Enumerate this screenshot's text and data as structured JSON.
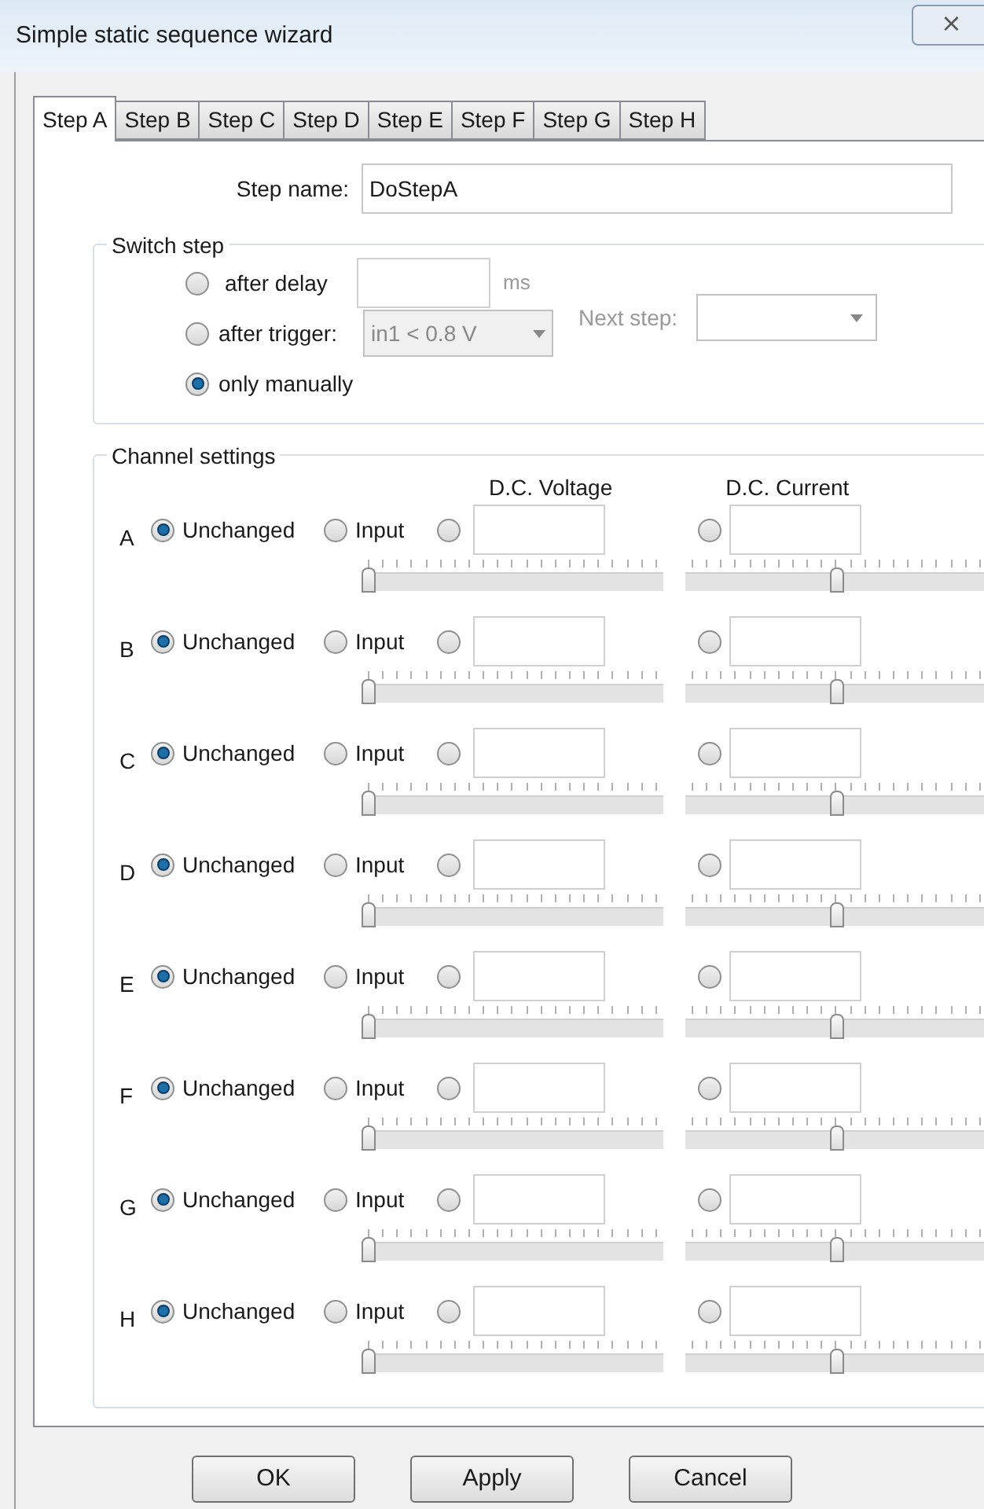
{
  "window": {
    "title": "Simple static sequence wizard",
    "close": "⨯"
  },
  "tabs": [
    {
      "label": "Step A",
      "selected": true
    },
    {
      "label": "Step B",
      "selected": false
    },
    {
      "label": "Step C",
      "selected": false
    },
    {
      "label": "Step D",
      "selected": false
    },
    {
      "label": "Step E",
      "selected": false
    },
    {
      "label": "Step F",
      "selected": false
    },
    {
      "label": "Step G",
      "selected": false
    },
    {
      "label": "Step H",
      "selected": false
    }
  ],
  "step_name": {
    "label": "Step name:",
    "value": "DoStepA"
  },
  "switch_step": {
    "title": "Switch step",
    "options": [
      {
        "kind": "delay",
        "label": "after delay",
        "selected": false,
        "unit": "ms"
      },
      {
        "kind": "trigger",
        "label": "after trigger:",
        "selected": false,
        "value": "in1 < 0.8 V"
      },
      {
        "kind": "manual",
        "label": "only manually",
        "selected": true
      }
    ],
    "next_step": {
      "label": "Next step:"
    }
  },
  "channel_settings": {
    "title": "Channel settings",
    "voltage_header": "D.C. Voltage",
    "current_header": "D.C. Current",
    "channels": [
      {
        "label": "A",
        "unchanged": {
          "label": "Unchanged",
          "selected": true
        },
        "input": {
          "label": "Input",
          "selected": false
        },
        "voltage": {
          "selected": false,
          "level": 0
        },
        "current": {
          "selected": false,
          "level": 0.5
        }
      },
      {
        "label": "B",
        "unchanged": {
          "label": "Unchanged",
          "selected": true
        },
        "input": {
          "label": "Input",
          "selected": false
        },
        "voltage": {
          "selected": false,
          "level": 0
        },
        "current": {
          "selected": false,
          "level": 0.5
        }
      },
      {
        "label": "C",
        "unchanged": {
          "label": "Unchanged",
          "selected": true
        },
        "input": {
          "label": "Input",
          "selected": false
        },
        "voltage": {
          "selected": false,
          "level": 0
        },
        "current": {
          "selected": false,
          "level": 0.5
        }
      },
      {
        "label": "D",
        "unchanged": {
          "label": "Unchanged",
          "selected": true
        },
        "input": {
          "label": "Input",
          "selected": false
        },
        "voltage": {
          "selected": false,
          "level": 0
        },
        "current": {
          "selected": false,
          "level": 0.5
        }
      },
      {
        "label": "E",
        "unchanged": {
          "label": "Unchanged",
          "selected": true
        },
        "input": {
          "label": "Input",
          "selected": false
        },
        "voltage": {
          "selected": false,
          "level": 0
        },
        "current": {
          "selected": false,
          "level": 0.5
        }
      },
      {
        "label": "F",
        "unchanged": {
          "label": "Unchanged",
          "selected": true
        },
        "input": {
          "label": "Input",
          "selected": false
        },
        "voltage": {
          "selected": false,
          "level": 0
        },
        "current": {
          "selected": false,
          "level": 0.5
        }
      },
      {
        "label": "G",
        "unchanged": {
          "label": "Unchanged",
          "selected": true
        },
        "input": {
          "label": "Input",
          "selected": false
        },
        "voltage": {
          "selected": false,
          "level": 0
        },
        "current": {
          "selected": false,
          "level": 0.5
        }
      },
      {
        "label": "H",
        "unchanged": {
          "label": "Unchanged",
          "selected": true
        },
        "input": {
          "label": "Input",
          "selected": false
        },
        "voltage": {
          "selected": false,
          "level": 0
        },
        "current": {
          "selected": false,
          "level": 0.5
        }
      }
    ]
  },
  "buttons": [
    "OK",
    "Apply",
    "Cancel"
  ]
}
